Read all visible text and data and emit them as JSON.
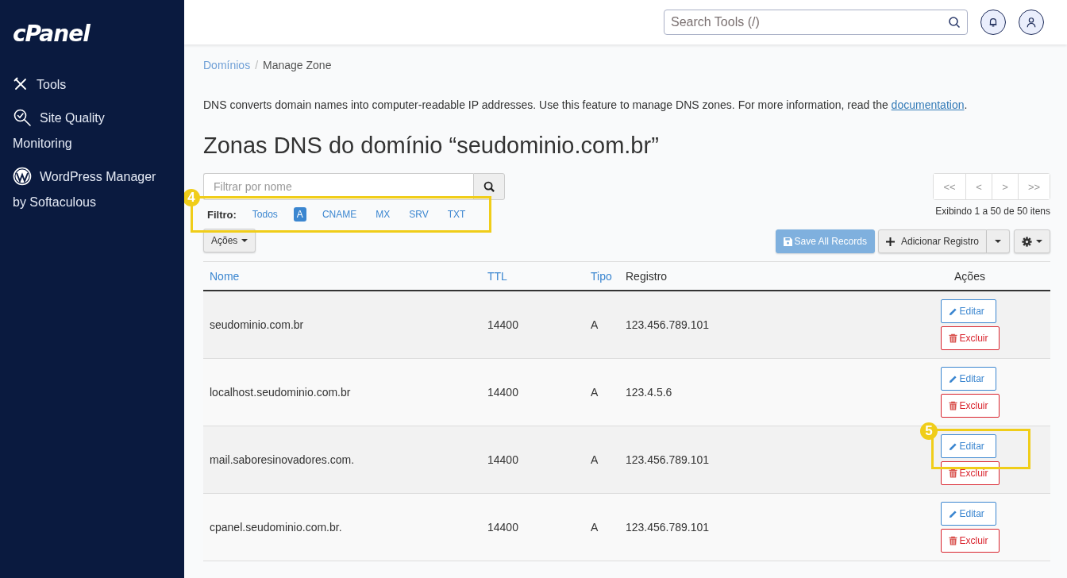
{
  "sidebar": {
    "logo": "cPanel",
    "items": [
      {
        "kind": "tools",
        "label": "Tools"
      },
      {
        "kind": "quality",
        "label": "Site Quality Monitoring"
      },
      {
        "kind": "wordpress",
        "label": "WordPress Manager by Softaculous"
      }
    ]
  },
  "header": {
    "search": {
      "placeholder": "Search Tools (/)"
    }
  },
  "breadcrumb": {
    "separator": "/",
    "items": [
      {
        "label": "Domínios",
        "link": true
      },
      {
        "label": "Manage Zone",
        "link": false
      }
    ]
  },
  "description": {
    "text": "DNS converts domain names into computer-readable IP addresses. Use this feature to manage DNS zones. For more information, read the ",
    "link": "documentation",
    "end": "."
  },
  "heading": "Zonas DNS do domínio “seudominio.com.br”",
  "filter": {
    "placeholder": "Filtrar por nome",
    "label": "Filtro:",
    "annotation": "4",
    "options": [
      {
        "label": "Todos",
        "selected": false
      },
      {
        "label": "A",
        "selected": true
      },
      {
        "label": "CNAME",
        "selected": false
      },
      {
        "label": "MX",
        "selected": false
      },
      {
        "label": "SRV",
        "selected": false
      },
      {
        "label": "TXT",
        "selected": false
      }
    ]
  },
  "pagination": {
    "buttons": [
      "<<",
      "<",
      ">",
      ">>"
    ],
    "summary": "Exibindo 1 a 50 de 50 itens"
  },
  "toolbar": {
    "actions": "Ações",
    "save": {
      "label": "Save All Records",
      "disabled": true
    },
    "add": "Adicionar Registro"
  },
  "table": {
    "columns": [
      {
        "label": "Nome",
        "sortable": true
      },
      {
        "label": "TTL",
        "sortable": true
      },
      {
        "label": "Tipo",
        "sortable": true
      },
      {
        "label": "Registro",
        "sortable": false
      },
      {
        "label": "Ações",
        "sortable": false
      }
    ],
    "rows": [
      {
        "name": "seudominio.com.br",
        "ttl": "14400",
        "type": "A",
        "record": "123.456.789.101",
        "edit": "Editar",
        "delete": "Excluir"
      },
      {
        "name": "localhost.seudominio.com.br",
        "ttl": "14400",
        "type": "A",
        "record": "123.4.5.6",
        "edit": "Editar",
        "delete": "Excluir"
      },
      {
        "name": "mail.saboresinovadores.com.",
        "ttl": "14400",
        "type": "A",
        "record": "123.456.789.101",
        "edit": "Editar",
        "delete": "Excluir",
        "annotation": "5"
      },
      {
        "name": "cpanel.seudominio.com.br.",
        "ttl": "14400",
        "type": "A",
        "record": "123.456.789.101",
        "edit": "Editar",
        "delete": "Excluir"
      }
    ]
  }
}
